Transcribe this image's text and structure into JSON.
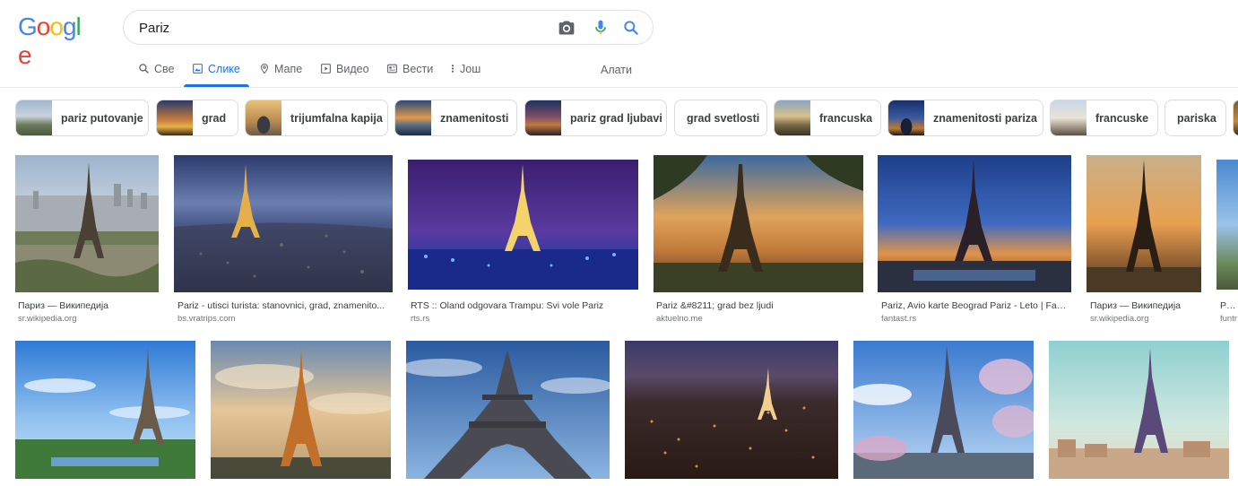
{
  "logo": {
    "letters": [
      "G",
      "o",
      "o",
      "g",
      "l",
      "e"
    ],
    "colors": [
      "#4285f4",
      "#ea4335",
      "#fbbc05",
      "#4285f4",
      "#34a853",
      "#ea4335"
    ]
  },
  "search": {
    "value": "Pariz"
  },
  "tabs": [
    {
      "label": "Све",
      "icon": "search-icon"
    },
    {
      "label": "Слике",
      "icon": "image-icon",
      "active": true
    },
    {
      "label": "Мапе",
      "icon": "map-pin-icon"
    },
    {
      "label": "Видео",
      "icon": "video-icon"
    },
    {
      "label": "Вести",
      "icon": "news-icon"
    },
    {
      "label": "Још",
      "icon": "more-vertical-icon"
    }
  ],
  "tools_label": "Алати",
  "chips": [
    {
      "label": "pariz putovanje"
    },
    {
      "label": "grad"
    },
    {
      "label": "trijumfalna kapija"
    },
    {
      "label": "znamenitosti"
    },
    {
      "label": "pariz grad ljubavi"
    },
    {
      "label": "grad svetlosti"
    },
    {
      "label": "francuska"
    },
    {
      "label": "znamenitosti pariza"
    },
    {
      "label": "francuske"
    },
    {
      "label": "pariska"
    }
  ],
  "results_row1": [
    {
      "title": "Париз — Википедија",
      "source": "sr.wikipedia.org"
    },
    {
      "title": "Pariz - utisci turista: stanovnici, grad, znamenito...",
      "source": "bs.vratrips.com"
    },
    {
      "title": "RTS :: Oland odgovara Trampu: Svi vole Pariz",
      "source": "rts.rs"
    },
    {
      "title": "Pariz &#8211; grad bez ljudi",
      "source": "aktuelno.me"
    },
    {
      "title": "Pariz, Avio karte Beograd Pariz - Leto | Fan...",
      "source": "fantast.rs"
    },
    {
      "title": "Париз — Википедија",
      "source": "sr.wikipedia.org"
    },
    {
      "title": "Pariz",
      "source": "funtr"
    }
  ],
  "results_row2_count": 6
}
